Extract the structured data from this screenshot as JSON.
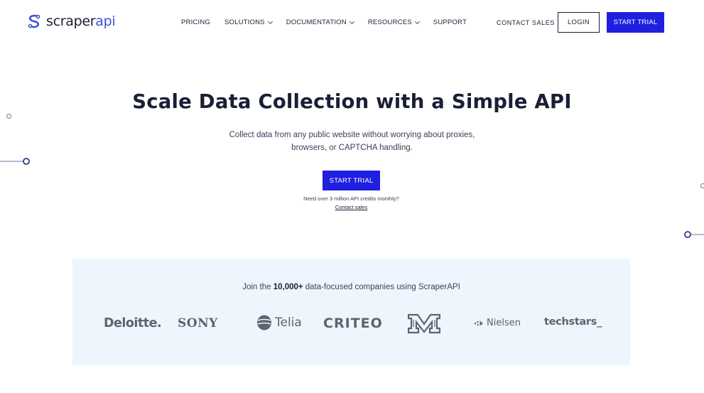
{
  "brand": {
    "name_part1": "scraper",
    "name_part2": "api",
    "color": "#3d52d5"
  },
  "nav": {
    "items": [
      {
        "label": "PRICING",
        "has_dropdown": false
      },
      {
        "label": "SOLUTIONS",
        "has_dropdown": true
      },
      {
        "label": "DOCUMENTATION",
        "has_dropdown": true
      },
      {
        "label": "RESOURCES",
        "has_dropdown": true
      },
      {
        "label": "SUPPORT",
        "has_dropdown": false
      }
    ],
    "contact_sales": "CONTACT SALES",
    "login": "LOGIN",
    "start_trial": "START TRIAL"
  },
  "hero": {
    "title": "Scale Data Collection with a Simple API",
    "subtitle": "Collect data from any public website without worrying about proxies, browsers, or CAPTCHA handling.",
    "cta": "START TRIAL",
    "credits_note": "Need over 3 million API credits monthly?",
    "contact_link": "Contact sales"
  },
  "clients": {
    "intro_prefix": "Join the ",
    "intro_bold": "10,000+",
    "intro_suffix": " data-focused companies using ScraperAPI",
    "logos": [
      "Deloitte.",
      "SONY",
      "Telia",
      "CRITEO",
      "Minnesota",
      "Nielsen",
      "techstars_"
    ]
  },
  "colors": {
    "primary_button": "#1f1fdf",
    "text_dark": "#1a1f36",
    "band_background": "#eef5fd",
    "logo_gray": "#5d6470"
  }
}
